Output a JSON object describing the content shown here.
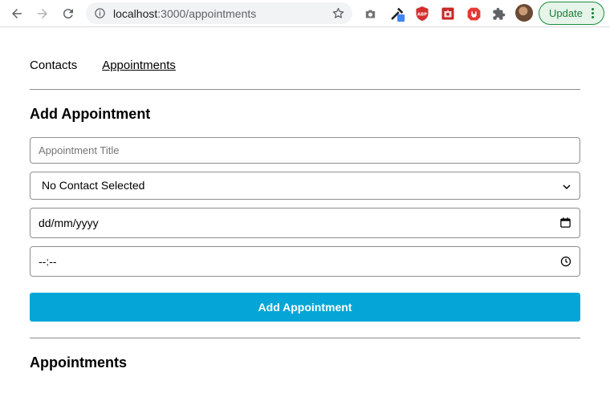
{
  "browser": {
    "url_host": "localhost",
    "url_path": ":3000/appointments",
    "update_label": "Update",
    "icons": [
      "back-icon",
      "forward-icon",
      "reload-icon",
      "info-icon",
      "bookmark-star-icon",
      "camera-icon",
      "eyedropper-icon",
      "shield-icon",
      "puzzle-icon-red",
      "hand-stop-icon",
      "extensions-icon",
      "profile-avatar",
      "more-icon"
    ]
  },
  "nav": {
    "contacts": "Contacts",
    "appointments": "Appointments"
  },
  "form": {
    "heading": "Add Appointment",
    "title_placeholder": "Appointment Title",
    "contact_select_value": "No Contact Selected",
    "date_value": "dd/mm/yyyy",
    "time_value": "--:--",
    "submit_label": "Add Appointment"
  },
  "list": {
    "heading": "Appointments"
  },
  "colors": {
    "accent": "#05a6d7",
    "update_green": "#188038"
  }
}
